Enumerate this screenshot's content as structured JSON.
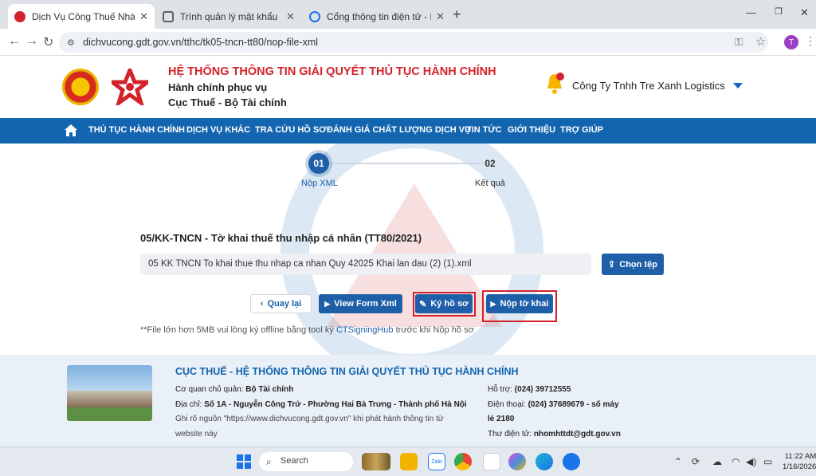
{
  "browser": {
    "tabs": [
      {
        "label": "Dịch Vụ Công Thuế Nhà Nước",
        "active": true,
        "favicon_color": "#d3222a"
      },
      {
        "label": "Trình quản lý mật khẩu",
        "active": false,
        "favicon_color": "#5f6368"
      },
      {
        "label": "Cổng thông tin điện tử - Bảo h",
        "active": false,
        "favicon_color": "#1a73e8"
      }
    ],
    "url": "dichvucong.gdt.gov.vn/tthc/tk05-tncn-tt80/nop-file-xml",
    "profile_initial": "T"
  },
  "header": {
    "title": "HỆ THỐNG THÔNG TIN GIẢI QUYẾT THỦ TỤC HÀNH CHÍNH",
    "line2": "Hành chính phục vụ",
    "line3": "Cục Thuế - Bộ Tài chính",
    "company": "Công Ty Tnhh Tre Xanh Logistics"
  },
  "menu": [
    "THỦ TỤC HÀNH CHÍNH",
    "DỊCH VỤ KHÁC",
    "TRA CỨU HỒ SƠ",
    "ĐÁNH GIÁ CHẤT LƯỢNG DỊCH VỤ",
    "TIN TỨC",
    "GIỚI THIỆU",
    "TRỢ GIÚP"
  ],
  "steps": [
    {
      "number": "01",
      "label": "Nộp XML",
      "active": true
    },
    {
      "number": "02",
      "label": "Kết quả",
      "active": false
    }
  ],
  "form": {
    "title": "05/KK-TNCN - Tờ khai thuế thu nhập cá nhân (TT80/2021)",
    "file_value": "05 KK TNCN To khai thue thu nhap ca nhan Quy 42025 Khai lan dau (2) (1).xml",
    "choose_file_label": "Chọn tệp",
    "back_label": "Quay lại",
    "view_label": "View Form Xml",
    "sign_label": "Ký hồ sơ",
    "submit_label": "Nộp tờ khai",
    "note_before": "**File lớn hơn 5MB vui lòng ký offline bằng tool ký ",
    "note_link": "CTSigningHub",
    "note_after": " trước khi Nộp hồ sơ"
  },
  "footer": {
    "title": "CỤC THUẾ - HỆ THỐNG THÔNG TIN GIẢI QUYẾT THỦ TỤC HÀNH CHÍNH",
    "agency_label": "Cơ quan chủ quản:",
    "agency": "Bộ Tài chính",
    "address_label": "Địa chỉ:",
    "address": "Số 1A - Nguyễn Công Trứ - Phường Hai Bà Trưng - Thành phố Hà Nội",
    "source_note_1": "Ghi rõ nguồn \"https://www.dichvucong.gdt.gov.vn\" khi phát hành thông tin từ",
    "source_note_2": "website này",
    "support_label": "Hỗ trợ:",
    "support": "(024) 39712555",
    "phone_label": "Điện thoại:",
    "phone": "(024) 37689679 - số máy",
    "phone_ext": "lẻ 2180",
    "email_label": "Thư điện tử:",
    "email": "nhomhttdt@gdt.gov.vn"
  },
  "taskbar": {
    "search_placeholder": "Search",
    "time": "11:22 AM",
    "date": "1/16/2026"
  }
}
